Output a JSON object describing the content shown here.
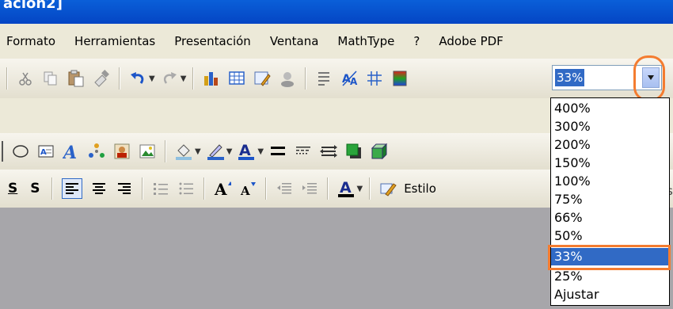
{
  "window": {
    "title_fragment": "ación2]"
  },
  "menu": {
    "items": [
      {
        "label": "Formato"
      },
      {
        "label": "Herramientas"
      },
      {
        "label": "Presentación"
      },
      {
        "label": "Ventana"
      },
      {
        "label": "MathType"
      },
      {
        "label": "?"
      },
      {
        "label": "Adobe PDF"
      }
    ]
  },
  "zoom": {
    "current_value": "33%",
    "options": [
      "400%",
      "300%",
      "200%",
      "150%",
      "100%",
      "75%",
      "66%",
      "50%",
      "33%",
      "25%",
      "Ajustar"
    ],
    "selected_index": 8
  },
  "toolbar3": {
    "style_button_label": "Estilo",
    "trailing_text": "s"
  },
  "colors": {
    "accent": "#316ac5",
    "highlight": "#f47c30",
    "title_bar": "#0a5fd8",
    "toolbar_bg": "#ece9d8"
  }
}
